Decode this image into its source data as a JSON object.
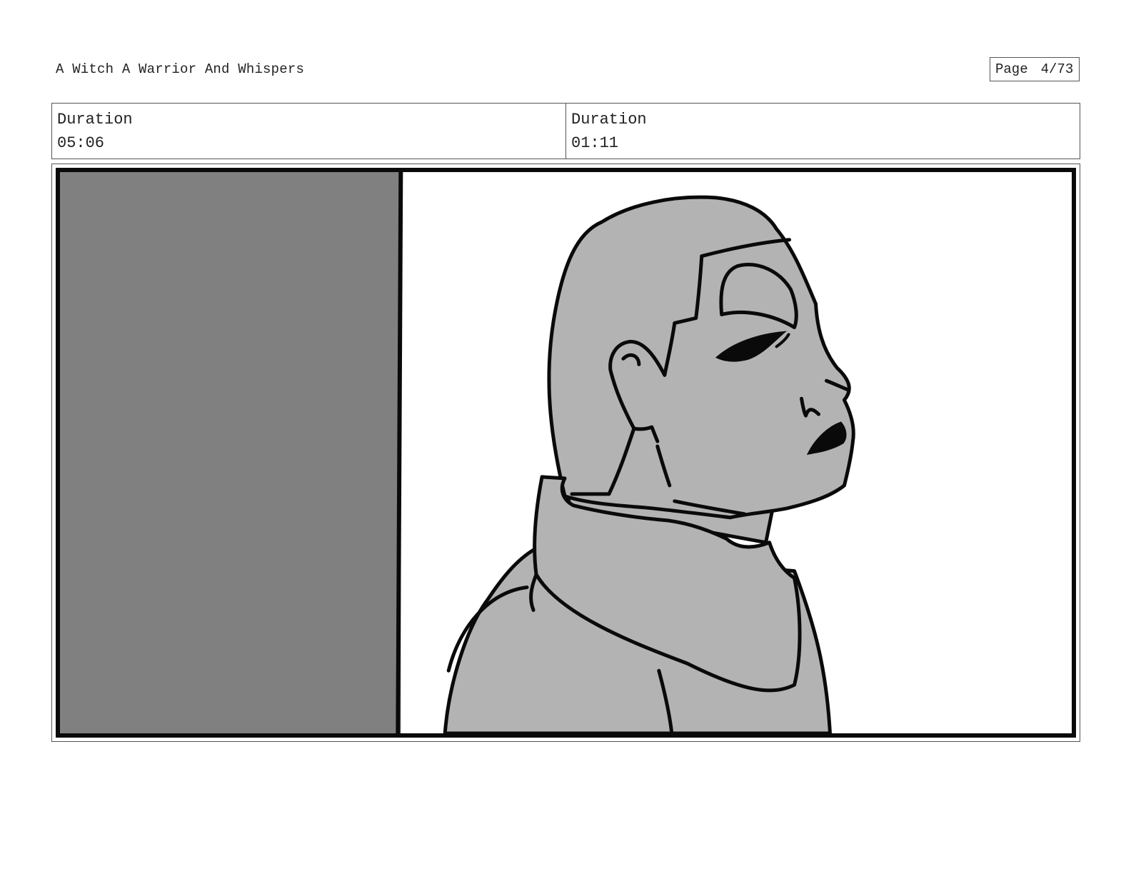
{
  "header": {
    "project_title": "A Witch A Warrior And Whispers",
    "page_label": "Page",
    "page_number": "4/73"
  },
  "panels": [
    {
      "duration_label": "Duration",
      "duration_value": "05:06"
    },
    {
      "duration_label": "Duration",
      "duration_value": "01:11"
    }
  ],
  "frame": {
    "description_colors": {
      "left_wall": "#808080",
      "figure_fill": "#b3b3b3",
      "line": "#0a0a0a"
    }
  }
}
